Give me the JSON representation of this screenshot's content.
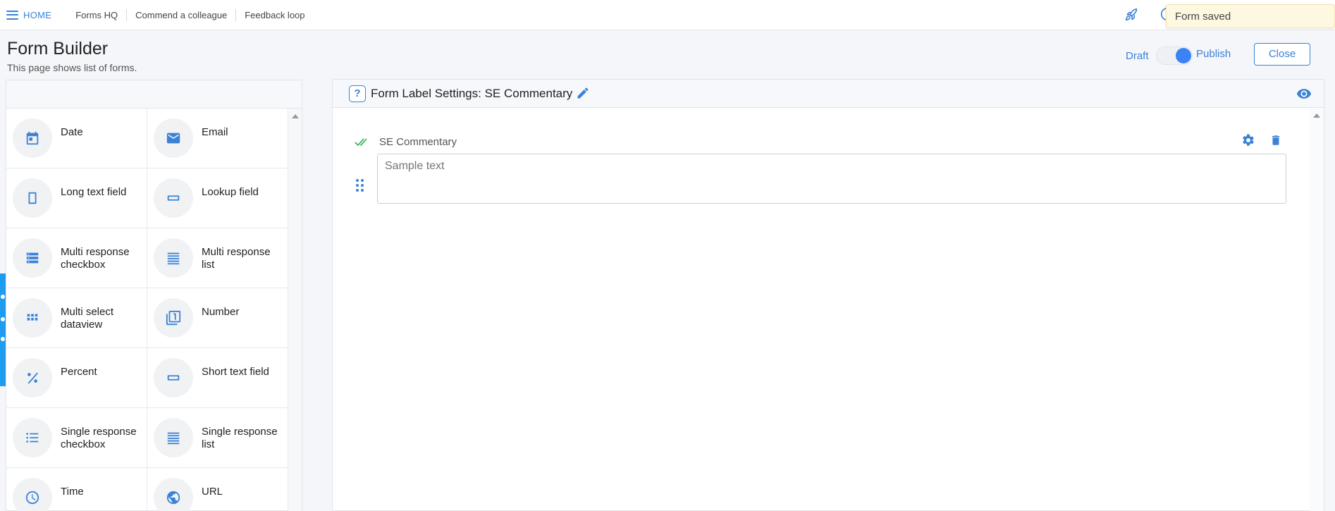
{
  "nav": {
    "home_label": "HOME",
    "links": [
      "Forms HQ",
      "Commend a colleague",
      "Feedback loop"
    ]
  },
  "toast": {
    "message": "Form saved"
  },
  "page": {
    "title": "Form Builder",
    "subtitle": "This page shows list of forms."
  },
  "publish_toggle": {
    "draft_label": "Draft",
    "publish_label": "Publish",
    "state": "Publish"
  },
  "close_label": "Close",
  "field_types": [
    {
      "label": "Date",
      "icon": "calendar-icon"
    },
    {
      "label": "Email",
      "icon": "envelope-icon"
    },
    {
      "label": "Long text field",
      "icon": "tall-rectangle-icon"
    },
    {
      "label": "Lookup field",
      "icon": "wide-rectangle-icon"
    },
    {
      "label": "Multi response checkbox",
      "icon": "stacked-rows-icon"
    },
    {
      "label": "Multi response list",
      "icon": "lines-list-icon"
    },
    {
      "label": "Multi select dataview",
      "icon": "grid-icon"
    },
    {
      "label": "Number",
      "icon": "numbered-stack-icon"
    },
    {
      "label": "Percent",
      "icon": "percent-icon"
    },
    {
      "label": "Short text field",
      "icon": "wide-rectangle-icon"
    },
    {
      "label": "Single response checkbox",
      "icon": "bullet-list-icon"
    },
    {
      "label": "Single response list",
      "icon": "lines-list-icon"
    },
    {
      "label": "Time",
      "icon": "clock-icon"
    },
    {
      "label": "URL",
      "icon": "globe-icon"
    }
  ],
  "editor": {
    "badge": "?",
    "title": "Form Label Settings: SE Commentary",
    "field": {
      "label": "SE Commentary",
      "placeholder": "Sample text"
    }
  },
  "colors": {
    "accent": "#3b82d6",
    "toggle_knob": "#3b82f6",
    "toast_bg": "#fff8e1",
    "side_tab": "#1e9cf0",
    "check": "#2eaa4f"
  }
}
